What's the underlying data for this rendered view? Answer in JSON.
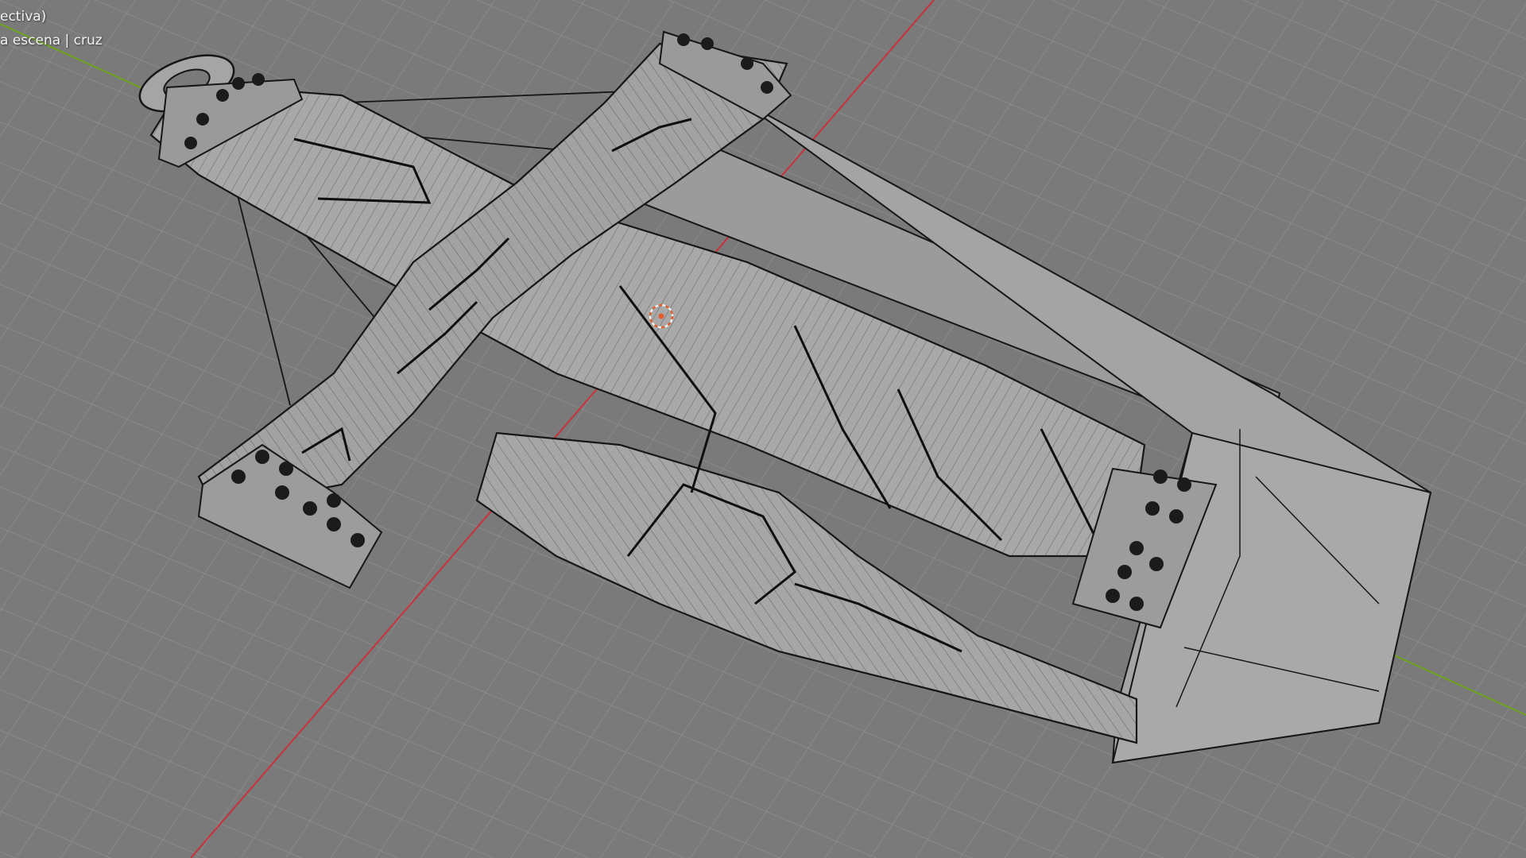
{
  "viewport": {
    "view_label": "ectiva)",
    "scene_label": "a escena | cruz"
  },
  "colors": {
    "background": "#7a7a7a",
    "grid_line": "#8f8f8f",
    "x_axis": "#c7323b",
    "y_axis": "#6fa21e",
    "mesh_fill": "#a7a7a7",
    "mesh_dark": "#929292",
    "wire": "#161616",
    "cursor": "#e35b27"
  },
  "icons": [
    "3d-cursor-icon"
  ]
}
